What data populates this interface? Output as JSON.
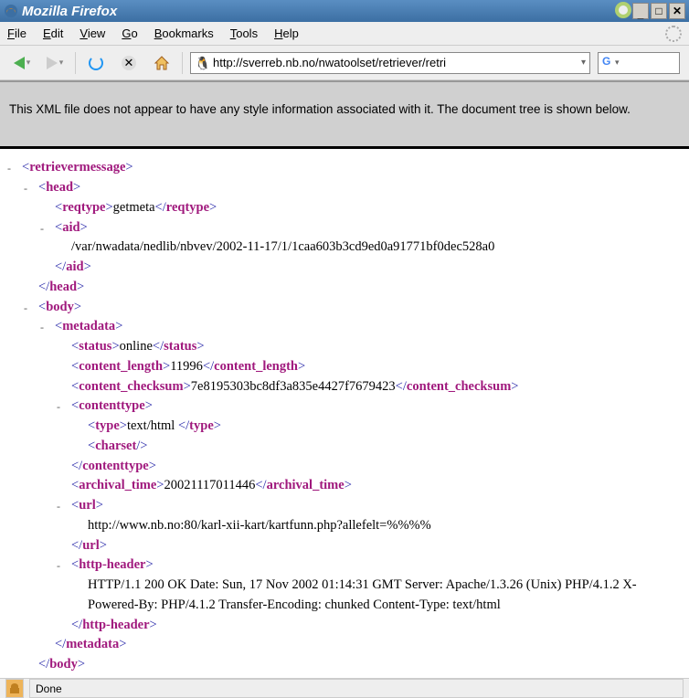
{
  "titlebar": {
    "text": "Mozilla Firefox"
  },
  "menubar": {
    "file": "File",
    "edit": "Edit",
    "view": "View",
    "go": "Go",
    "bookmarks": "Bookmarks",
    "tools": "Tools",
    "help": "Help"
  },
  "addressbar": {
    "url": "http://sverreb.nb.no/nwatoolset/retriever/retri"
  },
  "notice": {
    "text": "This XML file does not appear to have any style information associated with it. The document tree is shown below."
  },
  "xml": {
    "retrievermessage_open": "retrievermessage",
    "retrievermessage_close": "retrievermessage",
    "head_open": "head",
    "head_close": "head",
    "reqtype_open": "reqtype",
    "reqtype_val": "getmeta",
    "reqtype_close": "reqtype",
    "aid_open": "aid",
    "aid_val": "/var/nwadata/nedlib/nbvev/2002-11-17/1/1caa603b3cd9ed0a91771bf0dec528a0",
    "aid_close": "aid",
    "body_open": "body",
    "body_close": "body",
    "metadata_open": "metadata",
    "metadata_close": "metadata",
    "status_open": "status",
    "status_val": "online",
    "status_close": "status",
    "content_length_open": "content_length",
    "content_length_val": "11996",
    "content_length_close": "content_length",
    "content_checksum_open": "content_checksum",
    "content_checksum_val": "7e8195303bc8df3a835e4427f7679423",
    "content_checksum_close": "content_checksum",
    "contenttype_open": "contenttype",
    "contenttype_close": "contenttype",
    "type_open": "type",
    "type_val": "text/html ",
    "type_close": "type",
    "charset": "charset",
    "archival_time_open": "archival_time",
    "archival_time_val": "20021117011446",
    "archival_time_close": "archival_time",
    "url_open": "url",
    "url_val": "http://www.nb.no:80/karl-xii-kart/kartfunn.php?allefelt=%%%%",
    "url_close": "url",
    "http_header_open": "http-header",
    "http_header_val": "HTTP/1.1 200 OK Date: Sun, 17 Nov 2002 01:14:31 GMT Server: Apache/1.3.26 (Unix) PHP/4.1.2 X-Powered-By: PHP/4.1.2 Transfer-Encoding: chunked Content-Type: text/html",
    "http_header_close": "http-header"
  },
  "statusbar": {
    "text": "Done"
  }
}
